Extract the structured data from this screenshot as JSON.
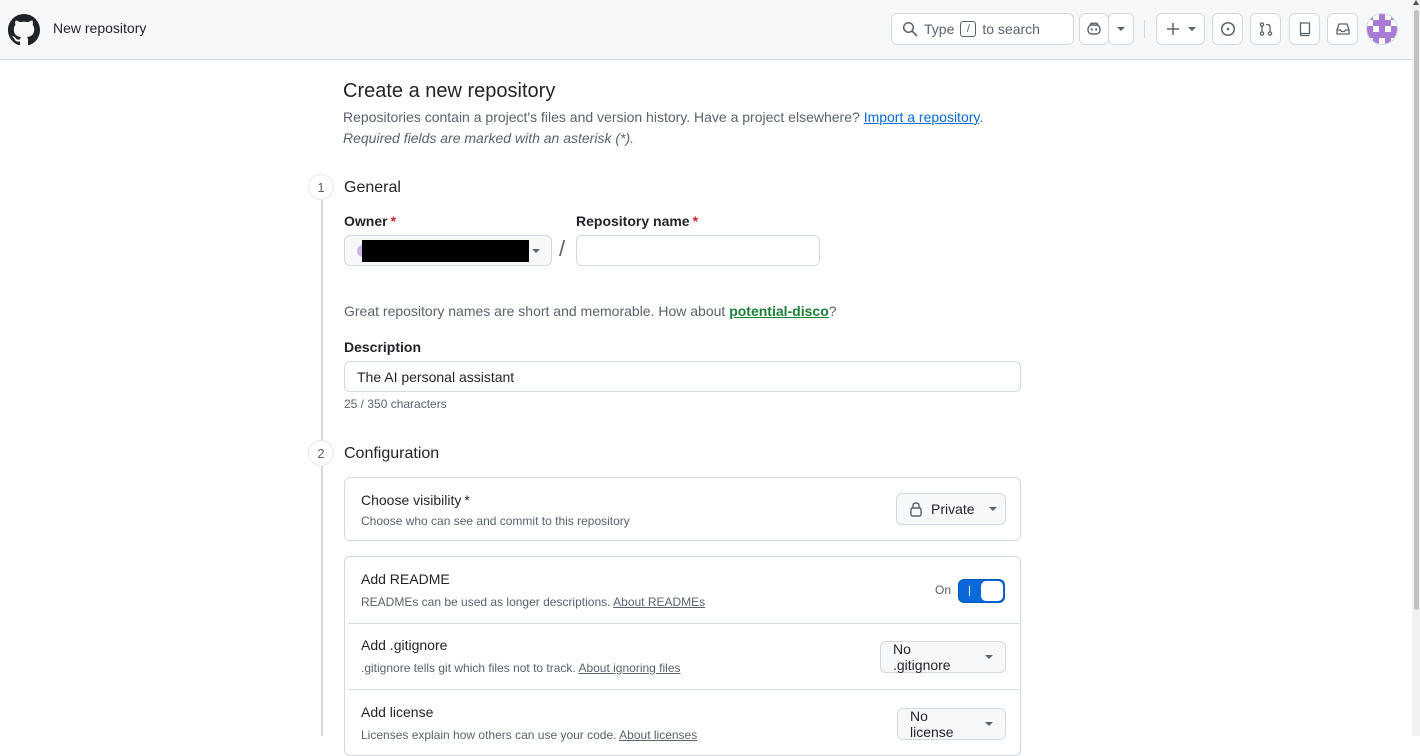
{
  "header": {
    "title": "New repository",
    "search": {
      "before": "Type",
      "key": "/",
      "after": "to search"
    }
  },
  "page": {
    "title": "Create a new repository",
    "subtitle": "Repositories contain a project's files and version history. Have a project elsewhere?",
    "import_link": "Import a repository",
    "subtitle_end": ".",
    "required_note": "Required fields are marked with an asterisk (*)."
  },
  "general": {
    "step": "1",
    "title": "General",
    "owner_label": "Owner",
    "repo_name_label": "Repository name",
    "required_mark": "*",
    "slash": "/",
    "repo_name_value": "",
    "hint_text": "Great repository names are short and memorable. How about",
    "hint_suggestion": "potential-disco",
    "hint_end": "?",
    "description_label": "Description",
    "description_value": "The AI personal assistant",
    "char_count": "25 / 350 characters"
  },
  "configuration": {
    "step": "2",
    "title": "Configuration",
    "visibility": {
      "title": "Choose visibility",
      "required_mark": "*",
      "desc": "Choose who can see and commit to this repository",
      "selected": "Private"
    },
    "readme": {
      "title": "Add README",
      "desc": "READMEs can be used as longer descriptions.",
      "link": "About READMEs",
      "toggle_label": "On",
      "enabled": true
    },
    "gitignore": {
      "title": "Add .gitignore",
      "desc": ".gitignore tells git which files not to track.",
      "link": "About ignoring files",
      "selected": "No .gitignore"
    },
    "license": {
      "title": "Add license",
      "desc": "Licenses explain how others can use your code.",
      "link": "About licenses",
      "selected": "No license"
    }
  },
  "icons": {
    "logo": "github-mark-icon",
    "search": "search-icon",
    "copilot": "copilot-icon",
    "plus": "plus-icon",
    "issues": "issue-opened-icon",
    "pulls": "git-pull-request-icon",
    "repo": "repo-icon",
    "inbox": "inbox-icon",
    "lock": "lock-icon"
  },
  "colors": {
    "accent": "#0969da",
    "success_link": "#1a7f37",
    "required": "#d1242f",
    "header_bg": "#f6f8fa",
    "border": "#d1d9e0"
  }
}
